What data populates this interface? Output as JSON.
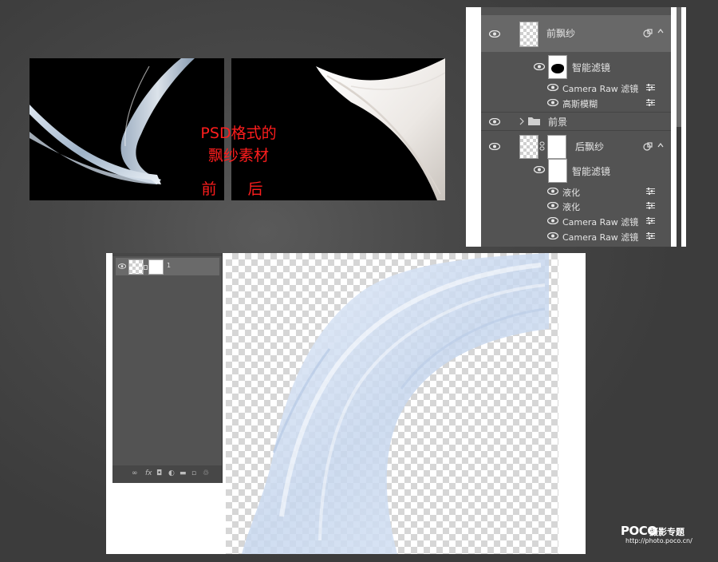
{
  "before_after": {
    "title_line1": "PSD格式的",
    "title_line2": "飘纱素材",
    "before_label": "前",
    "after_label": "后"
  },
  "layers_panel": {
    "rows": [
      {
        "name": "前飘纱",
        "kind": "smart-object-layer",
        "selected": true
      },
      {
        "name": "智能滤镜",
        "kind": "smart-filter-mask"
      },
      {
        "name": "Camera Raw 滤镜",
        "kind": "filter"
      },
      {
        "name": "高斯模糊",
        "kind": "filter"
      },
      {
        "name": "前景",
        "kind": "group"
      },
      {
        "name": "后飘纱",
        "kind": "smart-object-layer"
      },
      {
        "name": "智能滤镜",
        "kind": "smart-filter-mask"
      },
      {
        "name": "液化",
        "kind": "filter"
      },
      {
        "name": "液化",
        "kind": "filter"
      },
      {
        "name": "Camera Raw 滤镜",
        "kind": "filter"
      },
      {
        "name": "Camera Raw 滤镜",
        "kind": "filter"
      }
    ]
  },
  "mini_layers": {
    "layer_name": "1",
    "footer_icons": [
      "link-icon",
      "fx-icon",
      "mask-icon",
      "adjustment-icon",
      "folder-icon",
      "new-layer-icon",
      "trash-icon"
    ],
    "fx_label": "fx"
  },
  "watermark": {
    "logo": "POCO",
    "label": "摄影专题",
    "url": "http://photo.poco.cn/"
  },
  "colors": {
    "overlay_text": "#ff1d1d",
    "panel_bg": "#535353",
    "selected_row": "#686868"
  }
}
